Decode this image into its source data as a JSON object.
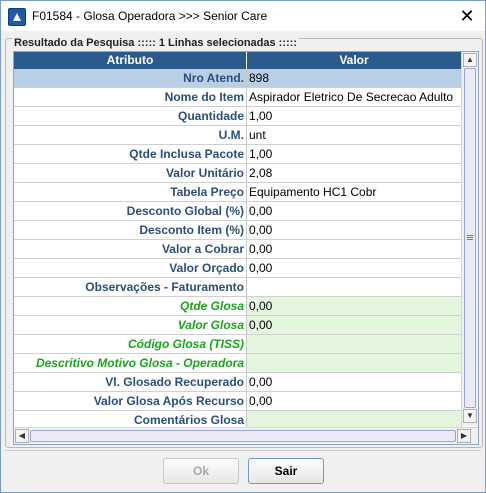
{
  "window": {
    "title": "F01584 - Glosa Operadora >>> Senior Care"
  },
  "panel": {
    "legend": "Resultado da Pesquisa ::::: 1 Linhas selecionadas :::::"
  },
  "table": {
    "columns": [
      "Atributo",
      "Valor"
    ],
    "rows": [
      {
        "attr": "Nro Atend.",
        "value": "898"
      },
      {
        "attr": "Nome do Item",
        "value": "Aspirador Eletrico De Secrecao Adulto"
      },
      {
        "attr": "Quantidade",
        "value": "1,00"
      },
      {
        "attr": "U.M.",
        "value": "unt"
      },
      {
        "attr": "Qtde Inclusa Pacote",
        "value": "1,00"
      },
      {
        "attr": "Valor Unitário",
        "value": "2,08"
      },
      {
        "attr": "Tabela Preço",
        "value": "Equipamento HC1 Cobr"
      },
      {
        "attr": "Desconto Global (%)",
        "value": "0,00"
      },
      {
        "attr": "Desconto Item (%)",
        "value": "0,00"
      },
      {
        "attr": "Valor a Cobrar",
        "value": "0,00"
      },
      {
        "attr": "Valor Orçado",
        "value": "0,00"
      },
      {
        "attr": "Observações - Faturamento",
        "value": ""
      },
      {
        "attr": "Qtde Glosa",
        "value": "0,00"
      },
      {
        "attr": "Valor Glosa",
        "value": "0,00"
      },
      {
        "attr": "Código Glosa (TISS)",
        "value": ""
      },
      {
        "attr": "Descritivo Motivo Glosa - Operadora",
        "value": ""
      },
      {
        "attr": "Vl. Glosado Recuperado",
        "value": "0,00"
      },
      {
        "attr": "Valor Glosa Após Recurso",
        "value": "0,00"
      },
      {
        "attr": "Comentários Glosa",
        "value": ""
      }
    ]
  },
  "buttons": {
    "ok": "Ok",
    "sair": "Sair"
  },
  "colors": {
    "header": "#2b5a8c",
    "selected_row": "#b8cfe6",
    "editable_cell": "#e3f5dc",
    "editable_label": "#1aa51a",
    "attr_text": "#2b4e7a"
  }
}
